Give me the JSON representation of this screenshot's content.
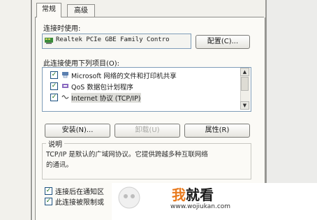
{
  "tabs": [
    {
      "label": "常规",
      "active": true
    },
    {
      "label": "高级",
      "active": false
    }
  ],
  "connect_using": {
    "label": "连接时使用:",
    "adapter_name": "Realtek PCIe GBE Family Contro",
    "configure_button": "配置(C)..."
  },
  "components": {
    "label": "此连接使用下列项目(O):",
    "items": [
      {
        "label": "Microsoft 网络的文件和打印机共享",
        "checked": true,
        "icon": "printer-share-icon"
      },
      {
        "label": "QoS 数据包计划程序",
        "checked": true,
        "icon": "qos-icon"
      },
      {
        "label": "Internet 协议 (TCP/IP)",
        "checked": true,
        "icon": "protocol-icon",
        "selected": true
      }
    ]
  },
  "buttons": {
    "install": "安装(N)...",
    "uninstall": "卸载(U)",
    "properties": "属性(R)"
  },
  "description": {
    "title": "说明",
    "text_line1": "TCP/IP 是默认的广域网协议。它提供跨越多种互联网络",
    "text_line2": "的通讯。"
  },
  "options": {
    "show_icon": "连接后在通知区",
    "notify": "此连接被限制或"
  },
  "watermark": {
    "title_part1": "我",
    "title_part2": "就看",
    "url": "www.wojiukan.com",
    "accent_color": "#e8791c"
  }
}
